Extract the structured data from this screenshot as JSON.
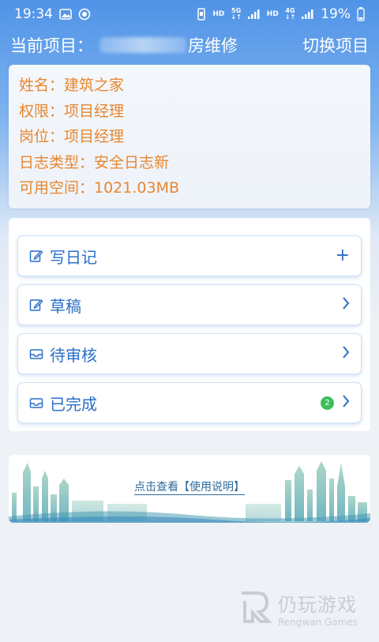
{
  "status_bar": {
    "time": "19:34",
    "battery": "19%",
    "hd1": "HD",
    "net1": "5G",
    "hd2": "HD",
    "net2": "4G"
  },
  "header": {
    "project_prefix": "当前项目：",
    "project_suffix": "房维修",
    "switch_label": "切换项目"
  },
  "info": {
    "name": "姓名：建筑之家",
    "permission": "权限：项目经理",
    "position": "岗位：项目经理",
    "log_type": "日志类型：安全日志新",
    "space": "可用空间：1021.03MB"
  },
  "menu": {
    "items": [
      {
        "label": "写日记",
        "icon": "edit-icon",
        "action": "+"
      },
      {
        "label": "草稿",
        "icon": "edit-icon"
      },
      {
        "label": "待审核",
        "icon": "inbox-icon"
      },
      {
        "label": "已完成",
        "icon": "inbox-icon",
        "badge": "2"
      }
    ]
  },
  "banner": {
    "link": "点击查看【使用说明】"
  },
  "watermark": {
    "cn": "仍玩游戏",
    "en": "Rengwan Games"
  },
  "colors": {
    "primary_blue": "#4f93e7",
    "orange_text": "#e8862f",
    "menu_text": "#2a6fc9",
    "badge_green": "#3cbf5a"
  }
}
